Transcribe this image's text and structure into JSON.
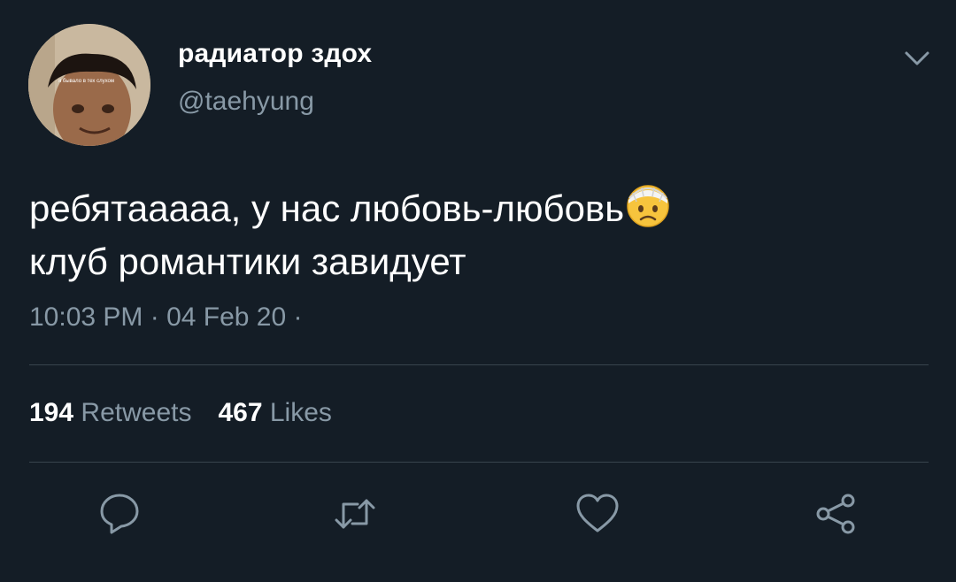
{
  "tweet": {
    "display_name": "радиатор здох",
    "handle": "@taehyung",
    "text_line_1": "ребятааааа, у нас любовь-любовь",
    "text_line_2": "клуб романтики завидует",
    "emoji": "face-with-head-bandage",
    "avatar_caption": "я бывало в тех слухом",
    "timestamp": "10:03 PM · 04 Feb 20 ·"
  },
  "stats": {
    "retweets_count": "194",
    "retweets_label": "Retweets",
    "likes_count": "467",
    "likes_label": "Likes"
  },
  "actions": {
    "reply_icon": "reply-icon",
    "retweet_icon": "retweet-icon",
    "like_icon": "heart-icon",
    "share_icon": "share-icon"
  },
  "colors": {
    "background": "#141d26",
    "primary_text": "#ffffff",
    "secondary_text": "#8899a6",
    "divider": "#38444d"
  }
}
